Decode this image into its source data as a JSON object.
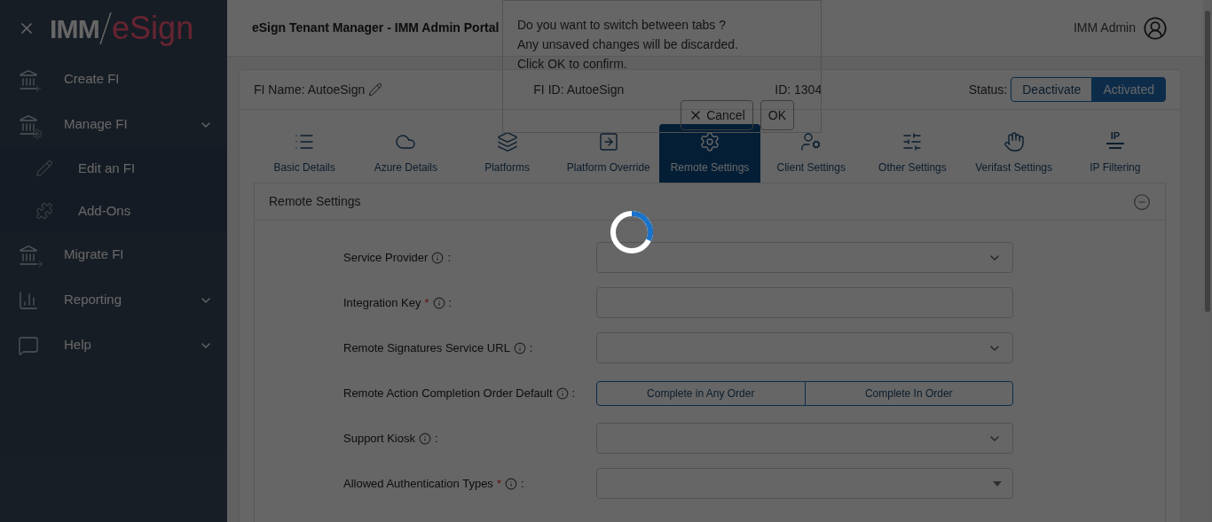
{
  "sidebar": {
    "logo_left": "IMM",
    "logo_right": "eSign",
    "items": [
      {
        "label": "Create FI",
        "expandable": false
      },
      {
        "label": "Manage FI",
        "expandable": true,
        "children": [
          {
            "label": "Edit an FI"
          },
          {
            "label": "Add-Ons"
          }
        ]
      },
      {
        "label": "Migrate FI",
        "expandable": false
      },
      {
        "label": "Reporting",
        "expandable": true
      },
      {
        "label": "Help",
        "expandable": true
      }
    ]
  },
  "header": {
    "title": "eSign Tenant Manager - IMM Admin Portal",
    "user": "IMM Admin"
  },
  "dialog": {
    "lines": [
      "Do you want to switch between tabs ?",
      "Any unsaved changes will be discarded.",
      "Click OK to confirm."
    ],
    "cancel": "Cancel",
    "ok": "OK"
  },
  "fi": {
    "name_label": "FI Name: AutoeSign",
    "fi_id": "FI ID: AutoeSign",
    "id": "ID: 1304",
    "status_label": "Status:",
    "status_options": [
      {
        "label": "Deactivate",
        "selected": false
      },
      {
        "label": "Activated",
        "selected": true
      }
    ]
  },
  "tabs": [
    {
      "label": "Basic Details",
      "selected": false
    },
    {
      "label": "Azure Details",
      "selected": false
    },
    {
      "label": "Platforms",
      "selected": false
    },
    {
      "label": "Platform Override",
      "selected": false
    },
    {
      "label": "Remote Settings",
      "selected": true
    },
    {
      "label": "Client Settings",
      "selected": false
    },
    {
      "label": "Other Settings",
      "selected": false
    },
    {
      "label": "Verifast Settings",
      "selected": false
    },
    {
      "label": "IP Filtering",
      "icon_text": "IP",
      "selected": false
    }
  ],
  "section": {
    "title": "Remote Settings",
    "expanded": true
  },
  "fields": [
    {
      "label": "Service Provider",
      "suffix": ":",
      "kind": "select"
    },
    {
      "label": "Integration Key",
      "required_mark": "*",
      "suffix": ":",
      "kind": "input"
    },
    {
      "label": "Remote Signatures Service URL",
      "suffix": ":",
      "kind": "select"
    },
    {
      "label": "Remote Action Completion Order Default",
      "suffix": ":",
      "kind": "toggle",
      "options": [
        {
          "label": "Complete in Any Order",
          "selected": false
        },
        {
          "label": "Complete In Order",
          "selected": false
        }
      ]
    },
    {
      "label": "Support Kiosk",
      "suffix": ":",
      "kind": "select"
    },
    {
      "label": "Allowed Authentication Types",
      "required_mark": "*",
      "suffix": ":",
      "kind": "multiselect"
    }
  ],
  "loading": true
}
